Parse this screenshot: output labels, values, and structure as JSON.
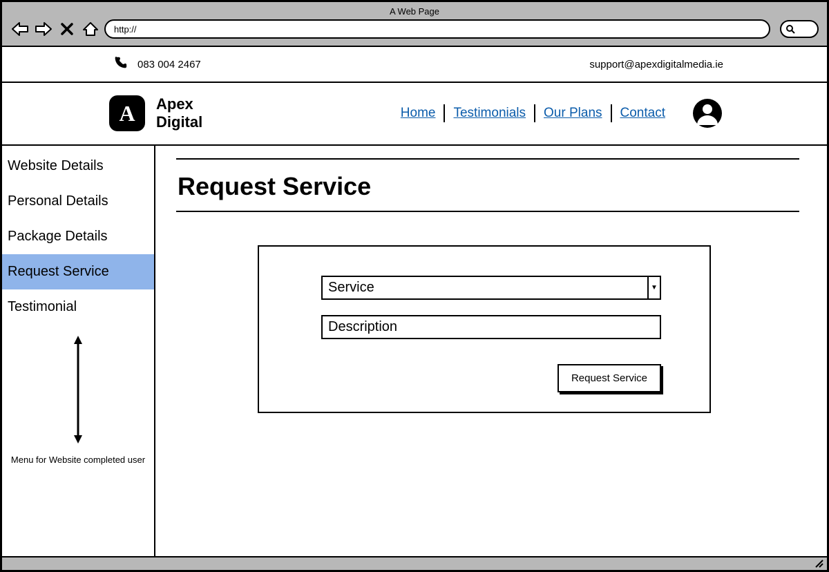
{
  "browser": {
    "title": "A Web Page",
    "url": "http://"
  },
  "infoBar": {
    "phone": "083 004 2467",
    "email": "support@apexdigitalmedia.ie"
  },
  "brand": {
    "logoLetter": "A",
    "line1": "Apex",
    "line2": "Digital"
  },
  "nav": {
    "home": "Home",
    "testimonials": "Testimonials",
    "plans": "Our Plans",
    "contact": "Contact"
  },
  "sidebar": {
    "items": [
      {
        "label": "Website Details"
      },
      {
        "label": "Personal Details"
      },
      {
        "label": "Package Details"
      },
      {
        "label": "Request Service"
      },
      {
        "label": "Testimonial"
      }
    ],
    "caption": "Menu for Website completed user"
  },
  "main": {
    "title": "Request Service",
    "serviceSelect": "Service",
    "descriptionPlaceholder": "Description",
    "submitLabel": "Request Service"
  }
}
